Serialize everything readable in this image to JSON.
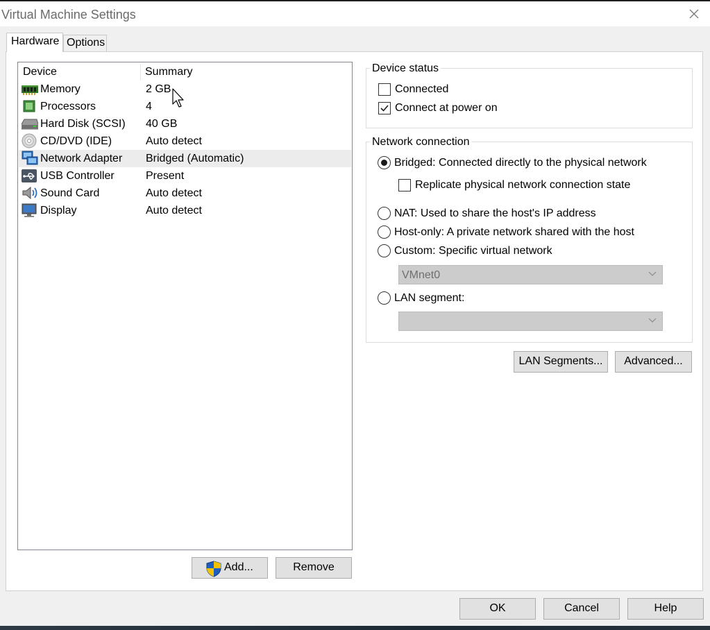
{
  "window": {
    "title": "Virtual Machine Settings",
    "close_icon": "close-icon"
  },
  "tabs": [
    {
      "label": "Hardware",
      "active": true
    },
    {
      "label": "Options",
      "active": false
    }
  ],
  "device_list": {
    "columns": [
      "Device",
      "Summary"
    ],
    "rows": [
      {
        "device": "Memory",
        "summary": "2 GB",
        "icon": "memory-icon"
      },
      {
        "device": "Processors",
        "summary": "4",
        "icon": "processor-icon"
      },
      {
        "device": "Hard Disk (SCSI)",
        "summary": "40 GB",
        "icon": "hard-disk-icon"
      },
      {
        "device": "CD/DVD (IDE)",
        "summary": "Auto detect",
        "icon": "cd-dvd-icon"
      },
      {
        "device": "Network Adapter",
        "summary": "Bridged (Automatic)",
        "icon": "network-adapter-icon",
        "selected": true
      },
      {
        "device": "USB Controller",
        "summary": "Present",
        "icon": "usb-icon"
      },
      {
        "device": "Sound Card",
        "summary": "Auto detect",
        "icon": "sound-card-icon"
      },
      {
        "device": "Display",
        "summary": "Auto detect",
        "icon": "display-icon"
      }
    ]
  },
  "list_buttons": {
    "add": "Add...",
    "remove": "Remove"
  },
  "device_status": {
    "legend": "Device status",
    "connected": {
      "label": "Connected",
      "checked": false
    },
    "connect_at_power_on": {
      "label": "Connect at power on",
      "checked": true
    }
  },
  "network_connection": {
    "legend": "Network connection",
    "bridged": {
      "label": "Bridged: Connected directly to the physical network",
      "selected": true
    },
    "replicate": {
      "label": "Replicate physical network connection state",
      "checked": false
    },
    "nat": {
      "label": "NAT: Used to share the host's IP address",
      "selected": false
    },
    "host_only": {
      "label": "Host-only: A private network shared with the host",
      "selected": false
    },
    "custom": {
      "label": "Custom: Specific virtual network",
      "selected": false
    },
    "custom_select_value": "VMnet0",
    "lan_segment": {
      "label": "LAN segment:",
      "selected": false
    },
    "lan_segment_select_value": ""
  },
  "network_buttons": {
    "lan_segments": "LAN Segments...",
    "advanced": "Advanced..."
  },
  "dialog_buttons": {
    "ok": "OK",
    "cancel": "Cancel",
    "help": "Help"
  },
  "colors": {
    "selected_row": "#ececec",
    "disabled_select": "#cccccc",
    "shield_blue": "#1f5fbf",
    "shield_yellow": "#f2c200"
  }
}
